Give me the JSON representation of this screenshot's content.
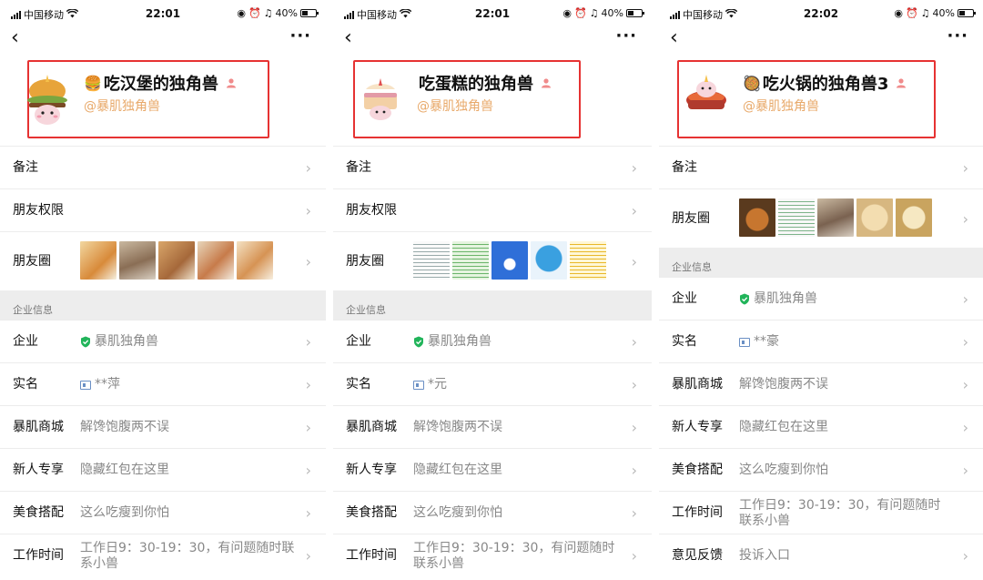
{
  "status": {
    "carrier": "中国移动",
    "battery": "40%",
    "battery_level": 0.4
  },
  "colors": {
    "highlight_border": "#e63232",
    "alias": "#e8a96a",
    "verified_green": "#21b45a",
    "section_bg": "#ededed"
  },
  "screens": [
    {
      "time": "22:01",
      "name": "吃汉堡的独角兽",
      "name_emoji": "🍔",
      "alias": "@暴肌独角兽",
      "rows": [
        {
          "label": "备注",
          "value": ""
        },
        {
          "label": "朋友权限",
          "value": ""
        },
        {
          "label": "朋友圈",
          "value": ""
        }
      ],
      "section_label": "企业信息",
      "company_rows": [
        {
          "label": "企业",
          "value": "暴肌独角兽",
          "icon": "verified-shield-icon"
        },
        {
          "label": "实名",
          "value": "**萍",
          "icon": "id-card-icon"
        },
        {
          "label": "暴肌商城",
          "value": "解馋饱腹两不误"
        },
        {
          "label": "新人专享",
          "value": "隐藏红包在这里"
        },
        {
          "label": "美食搭配",
          "value": "这么吃瘦到你怕"
        },
        {
          "label": "工作时间",
          "value": "工作日9：30-19：30，有问题随时联系小兽"
        }
      ]
    },
    {
      "time": "22:01",
      "name": "吃蛋糕的独角兽",
      "name_emoji": "",
      "alias": "@暴肌独角兽",
      "rows": [
        {
          "label": "备注",
          "value": ""
        },
        {
          "label": "朋友权限",
          "value": ""
        },
        {
          "label": "朋友圈",
          "value": ""
        }
      ],
      "section_label": "企业信息",
      "company_rows": [
        {
          "label": "企业",
          "value": "暴肌独角兽",
          "icon": "verified-shield-icon"
        },
        {
          "label": "实名",
          "value": "*元",
          "icon": "id-card-icon"
        },
        {
          "label": "暴肌商城",
          "value": "解馋饱腹两不误"
        },
        {
          "label": "新人专享",
          "value": "隐藏红包在这里"
        },
        {
          "label": "美食搭配",
          "value": "这么吃瘦到你怕"
        },
        {
          "label": "工作时间",
          "value": "工作日9：30-19：30，有问题随时联系小兽"
        }
      ]
    },
    {
      "time": "22:02",
      "name": "吃火锅的独角兽3",
      "name_emoji": "🥘",
      "alias": "@暴肌独角兽",
      "rows": [
        {
          "label": "备注",
          "value": ""
        },
        {
          "label": "朋友圈",
          "value": ""
        }
      ],
      "section_label": "企业信息",
      "company_rows": [
        {
          "label": "企业",
          "value": "暴肌独角兽",
          "icon": "verified-shield-icon"
        },
        {
          "label": "实名",
          "value": "**豪",
          "icon": "id-card-icon"
        },
        {
          "label": "暴肌商城",
          "value": "解馋饱腹两不误"
        },
        {
          "label": "新人专享",
          "value": "隐藏红包在这里"
        },
        {
          "label": "美食搭配",
          "value": "这么吃瘦到你怕"
        },
        {
          "label": "工作时间",
          "value": "工作日9：30-19：30，有问题随时联系小兽"
        },
        {
          "label": "意见反馈",
          "value": "投诉入口"
        }
      ]
    }
  ],
  "icons": {
    "back": "‹",
    "more": "···",
    "chevron": "›",
    "person": "person-icon"
  }
}
